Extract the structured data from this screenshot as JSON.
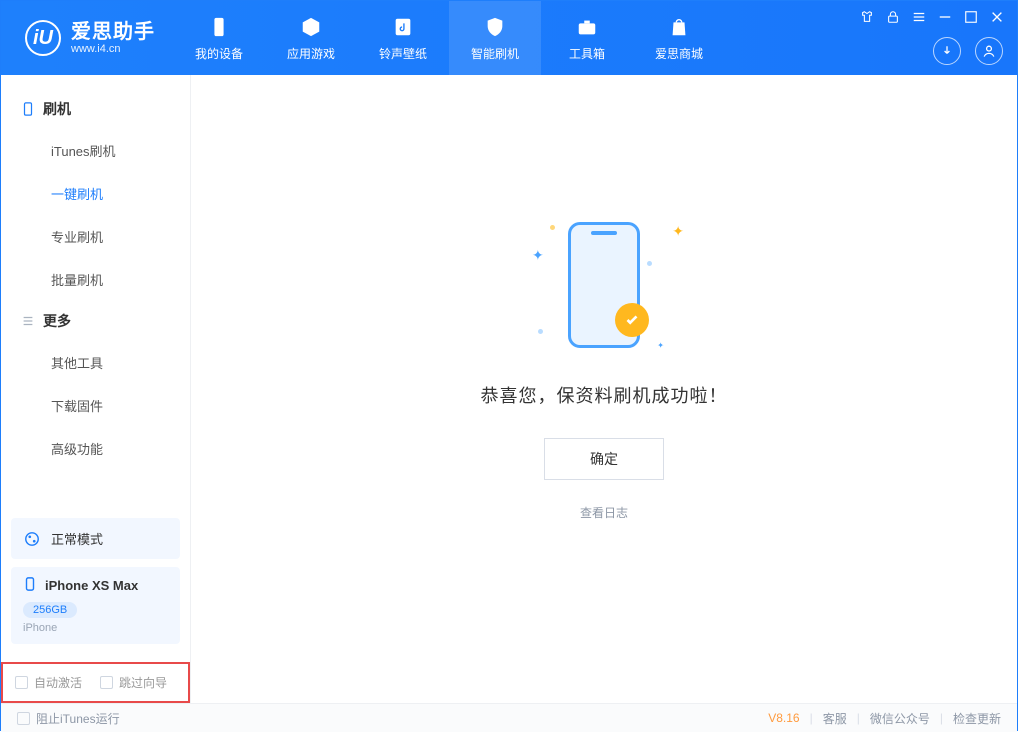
{
  "app": {
    "name": "爱思助手",
    "url": "www.i4.cn",
    "logo_letter": "iU"
  },
  "nav": {
    "items": [
      {
        "label": "我的设备"
      },
      {
        "label": "应用游戏"
      },
      {
        "label": "铃声壁纸"
      },
      {
        "label": "智能刷机",
        "active": true
      },
      {
        "label": "工具箱"
      },
      {
        "label": "爱思商城"
      }
    ]
  },
  "sidebar": {
    "section_flash": "刷机",
    "flash_items": [
      {
        "label": "iTunes刷机"
      },
      {
        "label": "一键刷机",
        "active": true
      },
      {
        "label": "专业刷机"
      },
      {
        "label": "批量刷机"
      }
    ],
    "section_more": "更多",
    "more_items": [
      {
        "label": "其他工具"
      },
      {
        "label": "下载固件"
      },
      {
        "label": "高级功能"
      }
    ],
    "mode_label": "正常模式",
    "device": {
      "name": "iPhone XS Max",
      "storage": "256GB",
      "os": "iPhone"
    },
    "checkbox_auto_activate": "自动激活",
    "checkbox_skip_guide": "跳过向导"
  },
  "main": {
    "success_text": "恭喜您，保资料刷机成功啦！",
    "ok_button": "确定",
    "view_log": "查看日志"
  },
  "footer": {
    "block_itunes": "阻止iTunes运行",
    "version": "V8.16",
    "link_support": "客服",
    "link_wechat": "微信公众号",
    "link_update": "检查更新"
  }
}
